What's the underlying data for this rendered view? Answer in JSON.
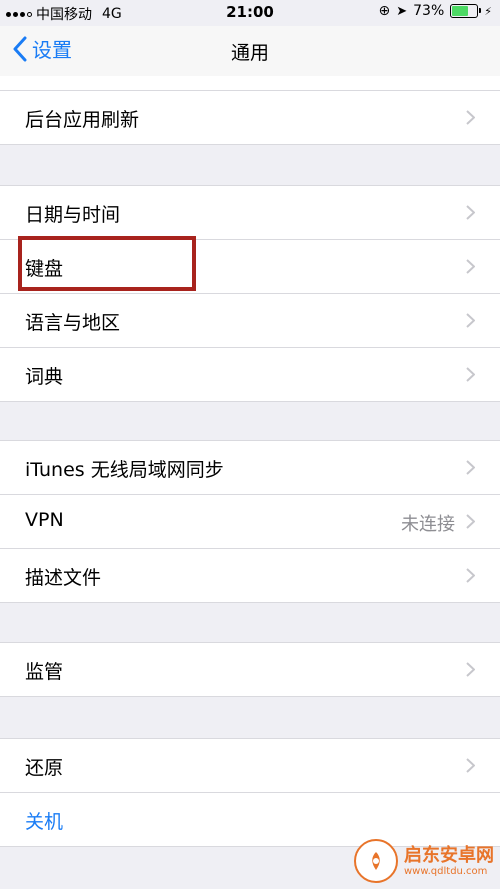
{
  "status": {
    "carrier": "中国移动",
    "network": "4G",
    "time": "21:00",
    "battery": "73%",
    "battery_level": 0.73
  },
  "nav": {
    "back_label": "设置",
    "title": "通用"
  },
  "groups": [
    {
      "rows": [
        {
          "label": "后台应用刷新"
        }
      ]
    },
    {
      "rows": [
        {
          "label": "日期与时间"
        },
        {
          "label": "键盘"
        },
        {
          "label": "语言与地区"
        },
        {
          "label": "词典"
        }
      ]
    },
    {
      "rows": [
        {
          "label": "iTunes 无线局域网同步"
        },
        {
          "label": "VPN",
          "value": "未连接"
        },
        {
          "label": "描述文件"
        }
      ]
    },
    {
      "rows": [
        {
          "label": "监管"
        }
      ]
    },
    {
      "rows": [
        {
          "label": "还原"
        },
        {
          "label": "关机"
        }
      ]
    }
  ],
  "watermark": {
    "name": "启东安卓网",
    "url": "www.qdltdu.com"
  },
  "colors": {
    "accent": "#1a7cf5",
    "highlight": "#a8231d",
    "battery": "#4cd964"
  }
}
